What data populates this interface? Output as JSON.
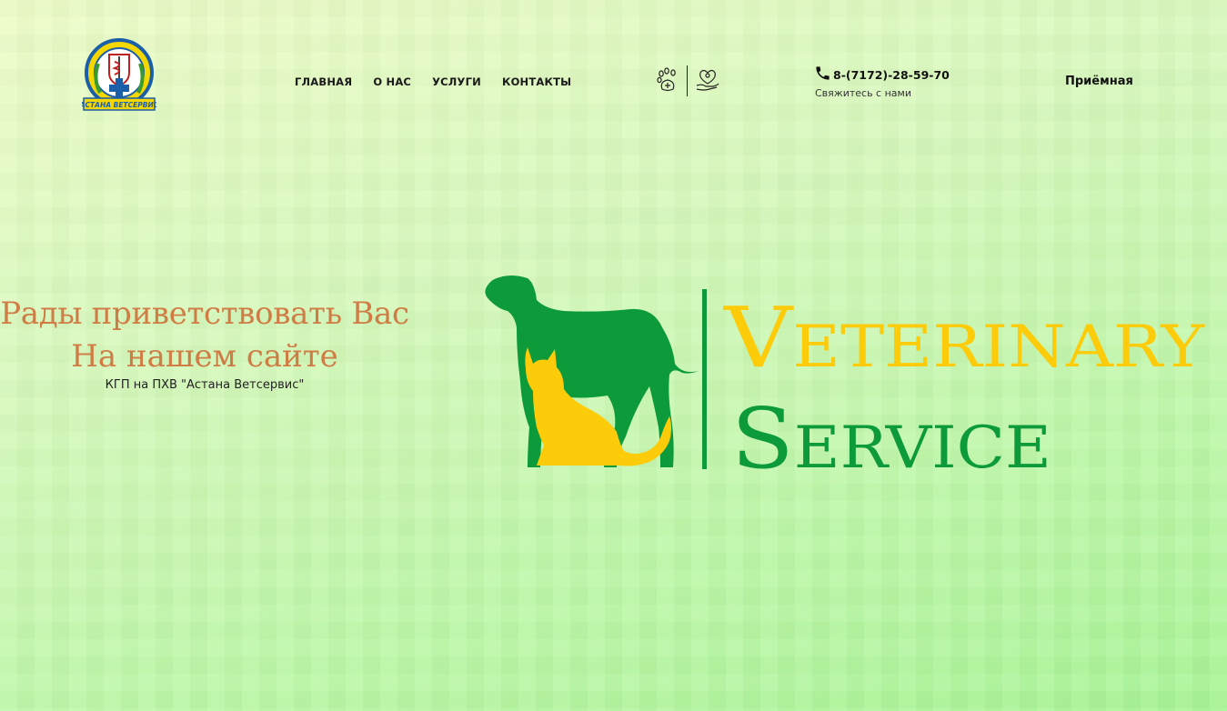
{
  "header": {
    "logo_text": "АСТАНА ВЕТСЕРВИС",
    "nav": [
      {
        "label": "ГЛАВНАЯ"
      },
      {
        "label": "О НАС"
      },
      {
        "label": "УСЛУГИ"
      },
      {
        "label": "КОНТАКТЫ"
      }
    ],
    "icons": [
      "paw-medical-icon",
      "heart-pet-care-icon"
    ],
    "phone": "8-(7172)-28-59-70",
    "phone_subtitle": "Свяжитесь с нами",
    "reception_label": "Приёмная"
  },
  "hero": {
    "line1": "Рады приветствовать Вас",
    "line2": "На нашем сайте",
    "subtitle": "КГП на ПХВ \"Астана Ветсервис\"",
    "logo_word1": "Veterinary",
    "logo_word2": "Service"
  },
  "colors": {
    "brand_green": "#0d9a3a",
    "brand_yellow": "#fccc0b",
    "heading_orange": "#cf7c45"
  }
}
